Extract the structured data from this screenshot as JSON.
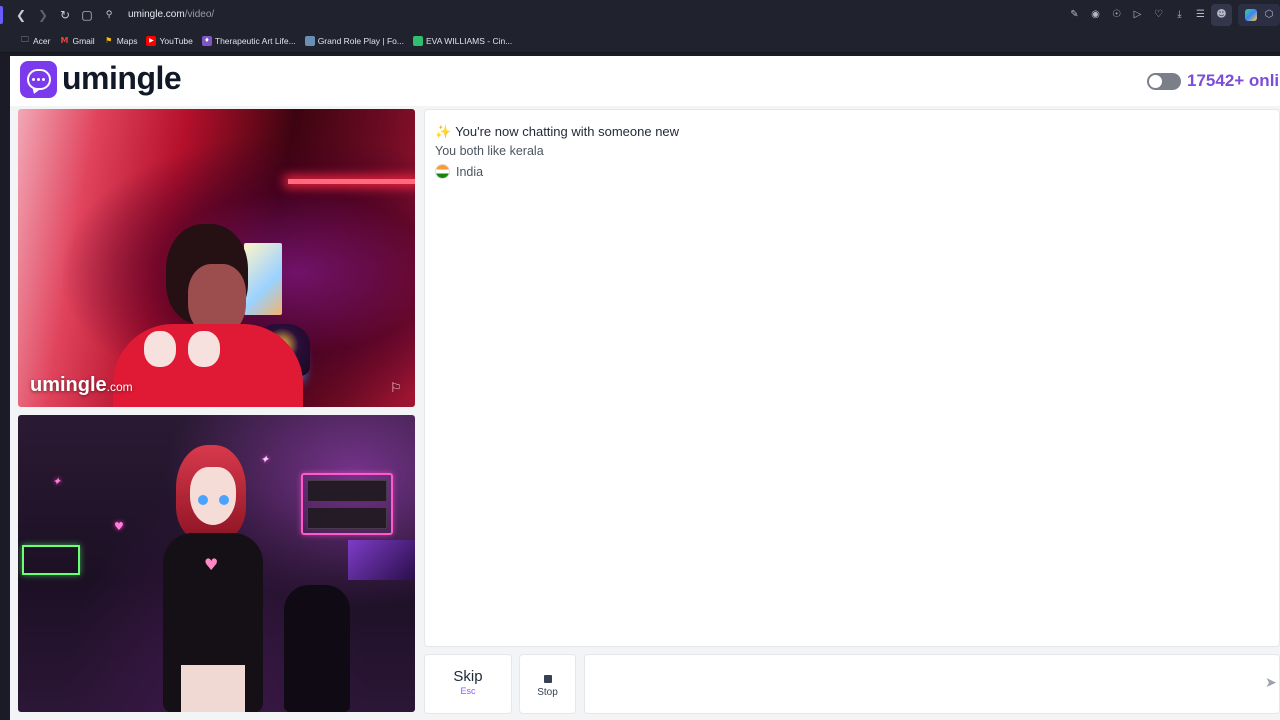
{
  "browser": {
    "url_host": "umingle.com",
    "url_path": "/video/",
    "icons": [
      "back-icon",
      "forward-icon",
      "reload-icon",
      "site-info-icon",
      "lock-icon"
    ],
    "toolbar_icons": [
      "edit-icon",
      "camera-icon",
      "shield-icon",
      "play-icon",
      "heart-icon",
      "download-icon",
      "menu-icon",
      "profile-icon"
    ]
  },
  "bookmarks": [
    {
      "label": "Acer",
      "icon": "folder-icon"
    },
    {
      "label": "Gmail",
      "icon": "gmail-icon"
    },
    {
      "label": "Maps",
      "icon": "maps-icon"
    },
    {
      "label": "YouTube",
      "icon": "youtube-icon"
    },
    {
      "label": "Therapeutic Art Life...",
      "icon": "bookmark-icon"
    },
    {
      "label": "Grand Role Play | Fo...",
      "icon": "bookmark-icon"
    },
    {
      "label": "EVA WILLIAMS - Cin...",
      "icon": "bookmark-icon"
    }
  ],
  "header": {
    "brand": "umingle",
    "online_count": "17542+ onli",
    "accent_color": "#7c3aed"
  },
  "video": {
    "watermark_brand": "umingle",
    "watermark_suffix": ".com"
  },
  "chat": {
    "title": "You're now chatting with someone new",
    "common_interest": "You both like kerala",
    "country": "India"
  },
  "controls": {
    "skip_label": "Skip",
    "skip_hint": "Esc",
    "stop_label": "Stop",
    "message_value": ""
  }
}
